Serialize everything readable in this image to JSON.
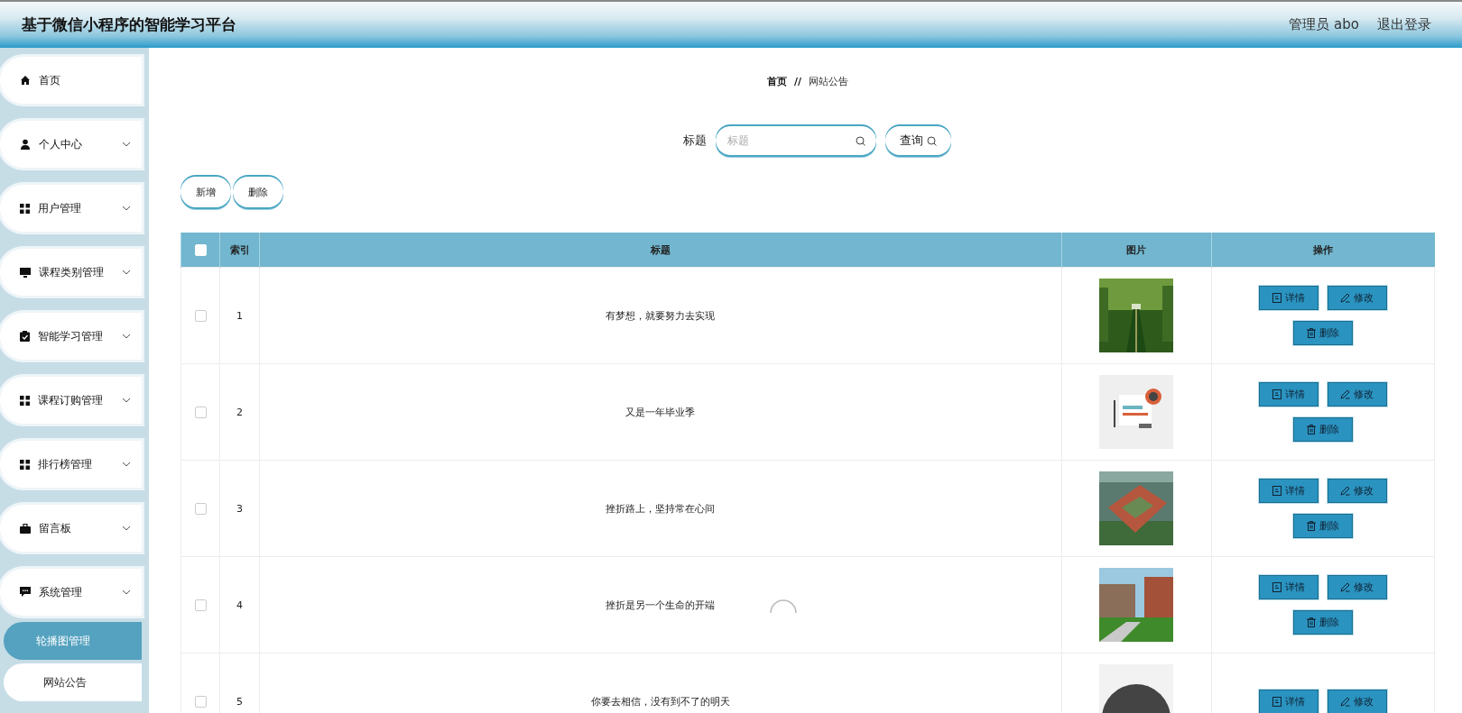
{
  "header": {
    "title": "基于微信小程序的智能学习平台",
    "user": "管理员 abo",
    "logout": "退出登录"
  },
  "sidebar": {
    "items": [
      {
        "label": "首页",
        "chevron": false
      },
      {
        "label": "个人中心",
        "chevron": true
      },
      {
        "label": "用户管理",
        "chevron": true
      },
      {
        "label": "课程类别管理",
        "chevron": true
      },
      {
        "label": "智能学习管理",
        "chevron": true
      },
      {
        "label": "课程订购管理",
        "chevron": true
      },
      {
        "label": "排行榜管理",
        "chevron": true
      },
      {
        "label": "留言板",
        "chevron": true
      },
      {
        "label": "系统管理",
        "chevron": true,
        "children": [
          {
            "label": "轮播图管理",
            "selected": true
          },
          {
            "label": "网站公告",
            "selected": false
          }
        ]
      }
    ]
  },
  "breadcrumb": {
    "items": [
      "首页",
      "网站公告"
    ],
    "separator": "//"
  },
  "search": {
    "label": "标题",
    "placeholder": "标题",
    "button": "查询"
  },
  "toolbar": [
    "新增",
    "删除"
  ],
  "table": {
    "select_all": {
      "checked": false
    },
    "columns": [
      "索引",
      "标题",
      "图片",
      "操作"
    ],
    "rows": [
      {
        "checked": false,
        "index": "1",
        "title": "有梦想，就要努力去实现",
        "picture": {
          "kind": "picture"
        },
        "actions": [
          {
            "kind": "detail",
            "label": "详情"
          },
          {
            "kind": "edit",
            "label": "修改"
          },
          {
            "kind": "delete",
            "label": "删除"
          }
        ]
      },
      {
        "checked": false,
        "index": "2",
        "title": "又是一年毕业季",
        "picture": {
          "kind": "picture"
        },
        "actions": [
          {
            "kind": "detail",
            "label": "详情"
          },
          {
            "kind": "edit",
            "label": "修改"
          },
          {
            "kind": "delete",
            "label": "删除"
          }
        ]
      },
      {
        "checked": false,
        "index": "3",
        "title": "挫折路上，坚持常在心间",
        "picture": {
          "kind": "picture"
        },
        "actions": [
          {
            "kind": "detail",
            "label": "详情"
          },
          {
            "kind": "edit",
            "label": "修改"
          },
          {
            "kind": "delete",
            "label": "删除"
          }
        ]
      },
      {
        "checked": false,
        "index": "4",
        "title": "挫折是另一个生命的开端",
        "picture": {
          "kind": "picture"
        },
        "actions": [
          {
            "kind": "detail",
            "label": "详情"
          },
          {
            "kind": "edit",
            "label": "修改"
          },
          {
            "kind": "delete",
            "label": "删除"
          }
        ]
      },
      {
        "checked": false,
        "index": "5",
        "title": "你要去相信，没有到不了的明天",
        "picture": {
          "kind": "picture"
        },
        "actions": [
          {
            "kind": "detail",
            "label": "详情"
          },
          {
            "kind": "edit",
            "label": "修改"
          }
        ]
      }
    ]
  },
  "loading": true
}
